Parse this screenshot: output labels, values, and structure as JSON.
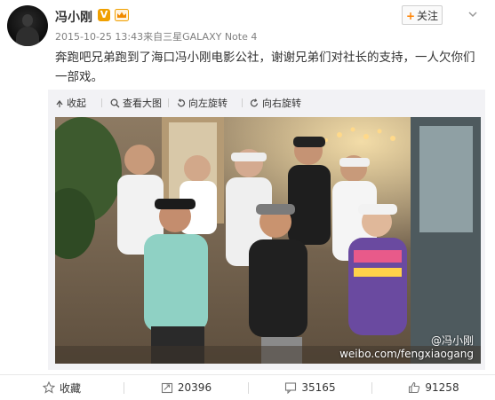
{
  "post": {
    "author": "冯小刚",
    "verified_badge": "V",
    "follow_label": "关注",
    "follow_plus": "+",
    "timestamp": "2015-10-25 13:43",
    "source_prefix": "来自",
    "device": "三星GALAXY Note 4",
    "text": "奔跑吧兄弟跑到了海口冯小刚电影公社，谢谢兄弟们对社长的支持，一人欠你们一部戏。"
  },
  "media_toolbar": {
    "collapse": "收起",
    "view_large": "查看大图",
    "rotate_left": "向左旋转",
    "rotate_right": "向右旋转"
  },
  "photo": {
    "watermark_handle": "@冯小刚",
    "watermark_url": "weibo.com/fengxiaogang"
  },
  "actions": {
    "favorite": "收藏",
    "repost_count": "20396",
    "comment_count": "35165",
    "like_count": "91258"
  },
  "colors": {
    "accent": "#ff8200",
    "verified": "#f0a000",
    "text": "#333333",
    "muted": "#808080",
    "panel": "#f2f2f5"
  }
}
